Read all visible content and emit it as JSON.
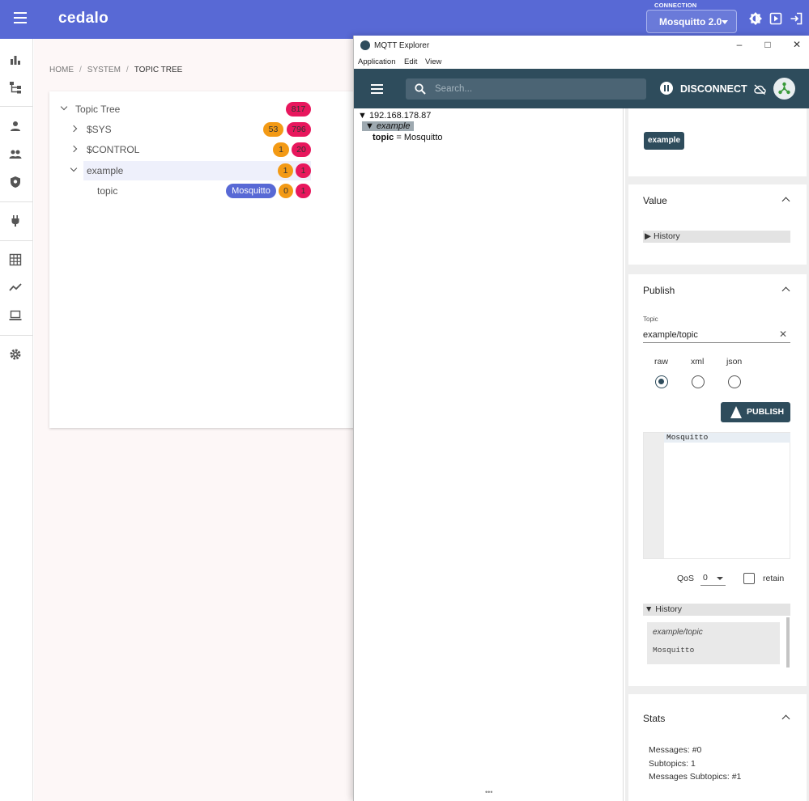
{
  "cedalo": {
    "brand": "cedalo",
    "connection_label": "CONNECTION",
    "connection_value": "Mosquitto 2.0",
    "breadcrumb": {
      "home": "HOME",
      "system": "SYSTEM",
      "current": "TOPIC TREE",
      "separator": "/"
    },
    "tree": {
      "root": {
        "label": "Topic Tree",
        "count": "817"
      },
      "sys": {
        "label": "$SYS",
        "count_orange": "53",
        "count_red": "796"
      },
      "control": {
        "label": "$CONTROL",
        "count_orange": "1",
        "count_red": "20"
      },
      "example": {
        "label": "example",
        "count_orange": "1",
        "count_red": "1"
      },
      "topic": {
        "label": "topic",
        "value": "Mosquitto",
        "count_orange": "0",
        "count_red": "1"
      }
    },
    "colors": {
      "header": "#5869d5",
      "badge_red": "#e8175d",
      "badge_orange": "#f39a15",
      "badge_blue": "#5869d5"
    },
    "icons": [
      "menu-icon",
      "brightness-icon",
      "play-box-icon",
      "logout-icon",
      "bar-chart-icon",
      "hierarchy-icon",
      "person-icon",
      "group-icon",
      "shield-icon",
      "plug-icon",
      "grid-icon",
      "trend-icon",
      "laptop-icon",
      "gear-icon"
    ]
  },
  "mqtt": {
    "window_title": "MQTT Explorer",
    "menu": [
      "Application",
      "Edit",
      "View"
    ],
    "search_placeholder": "Search...",
    "disconnect_label": "DISCONNECT",
    "tree": {
      "host": "▼ 192.168.178.87",
      "example": "▼ example",
      "topic_key": "topic",
      "topic_value": " = Mosquitto"
    },
    "topic_chip": "example",
    "value_section": {
      "title": "Value",
      "history": "▶ History"
    },
    "publish": {
      "title": "Publish",
      "topic_label": "Topic",
      "topic_value": "example/topic",
      "formats": [
        "raw",
        "xml",
        "json"
      ],
      "selected_format": "raw",
      "button": "PUBLISH",
      "editor_text": "Mosquitto",
      "qos_label": "QoS",
      "qos_value": "0",
      "retain_label": "retain",
      "history_label": "▼ History",
      "history_topic": "example/topic",
      "history_value": "Mosquitto"
    },
    "stats": {
      "title": "Stats",
      "messages": "Messages: #0",
      "subtopics": "Subtopics: 1",
      "messages_subtopics": "Messages Subtopics: #1"
    },
    "colors": {
      "toolbar": "#2e4c5c",
      "search_bg": "#4b6474"
    }
  }
}
